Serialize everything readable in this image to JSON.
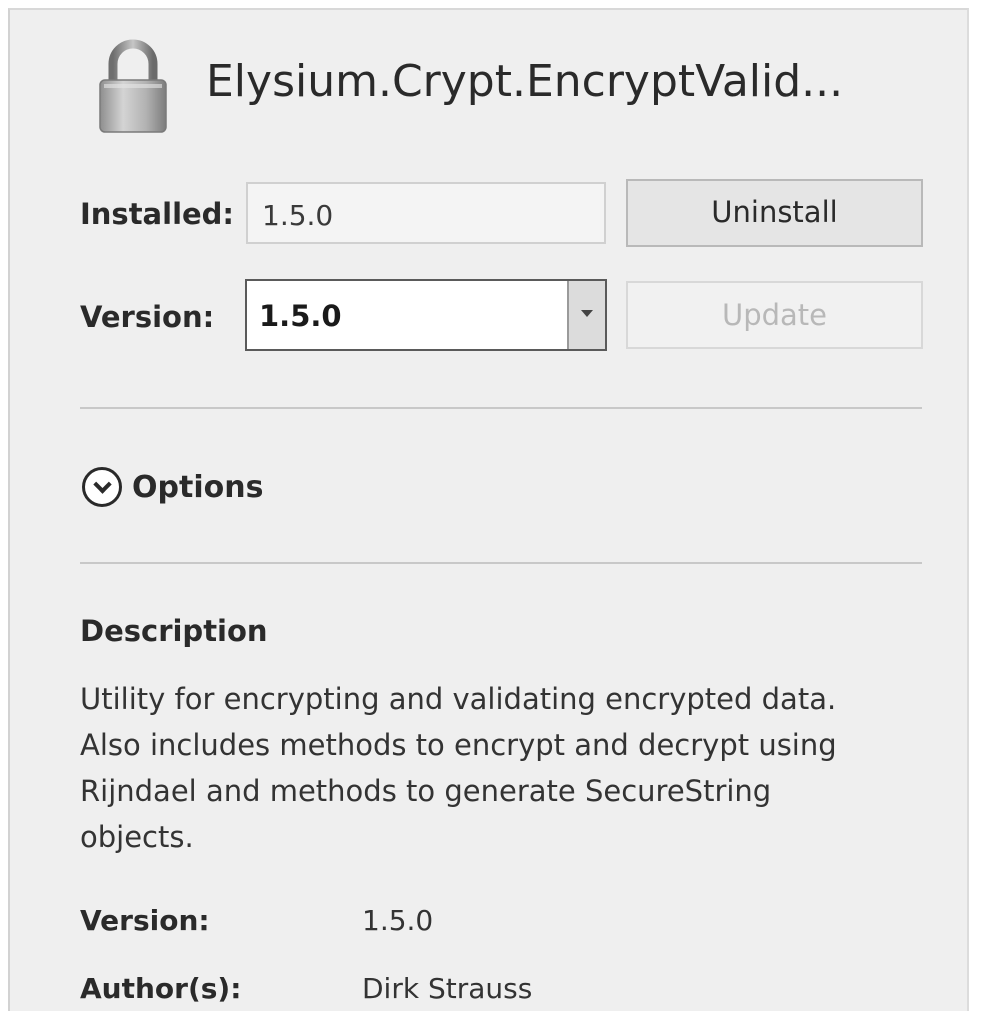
{
  "package": {
    "title": "Elysium.Crypt.EncryptValid...",
    "icon": "lock-icon"
  },
  "install_row": {
    "label": "Installed:",
    "value": "1.5.0",
    "button_label": "Uninstall"
  },
  "version_row": {
    "label": "Version:",
    "selected": "1.5.0",
    "button_label": "Update"
  },
  "options": {
    "label": "Options",
    "icon": "chevron-down-icon"
  },
  "description": {
    "heading": "Description",
    "lines": [
      "Utility for encrypting and validating encrypted data.",
      "Also includes methods to encrypt and decrypt using",
      "Rijndael and methods to generate SecureString",
      "objects."
    ]
  },
  "metadata": [
    {
      "label": "Version:",
      "value": "1.5.0"
    },
    {
      "label": "Author(s):",
      "value": "Dirk Strauss"
    }
  ],
  "colors": {
    "panel_background": "#efefef",
    "disabled_text": "#b8b8b8",
    "text": "#2a2a2a"
  }
}
